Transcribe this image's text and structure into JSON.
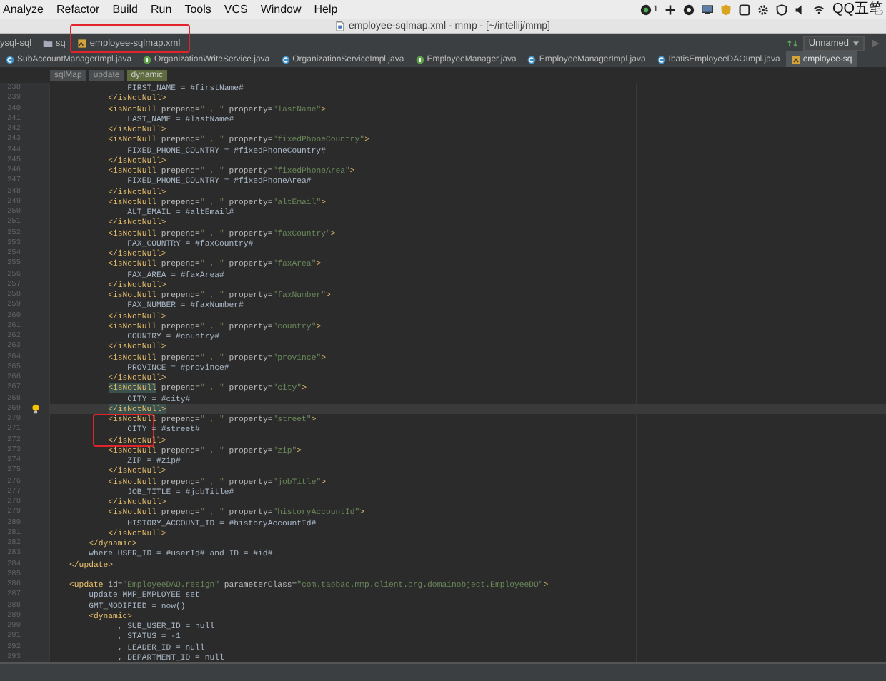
{
  "menu_bar": {
    "items": [
      "Analyze",
      "Refactor",
      "Build",
      "Run",
      "Tools",
      "VCS",
      "Window",
      "Help"
    ],
    "tray": {
      "badge": "1",
      "input_method": "QQ五笔"
    }
  },
  "window": {
    "title": "employee-sqlmap.xml - mmp - [~/intellij/mmp]"
  },
  "nav_bar": {
    "crumbs": [
      {
        "kind": "module",
        "text": "ysql-sql",
        "annotated": false
      },
      {
        "kind": "folder",
        "text": "sq",
        "annotated": false
      },
      {
        "kind": "xml",
        "text": "employee-sqlmap.xml",
        "annotated": true
      }
    ],
    "run_config": "Unnamed"
  },
  "tabs": [
    {
      "kind": "class",
      "label": "SubAccountManagerImpl.java",
      "selected": false
    },
    {
      "kind": "interface",
      "label": "OrganizationWriteService.java",
      "selected": false
    },
    {
      "kind": "class",
      "label": "OrganizationServiceImpl.java",
      "selected": false
    },
    {
      "kind": "interface",
      "label": "EmployeeManager.java",
      "selected": false
    },
    {
      "kind": "class",
      "label": "EmployeeManagerImpl.java",
      "selected": false
    },
    {
      "kind": "class",
      "label": "IbatisEmployeeDAOImpl.java",
      "selected": false
    },
    {
      "kind": "xml",
      "label": "employee-sq",
      "selected": true
    }
  ],
  "breadcrumb": [
    {
      "label": "sqlMap",
      "selected": false
    },
    {
      "label": "update",
      "selected": false
    },
    {
      "label": "dynamic",
      "selected": true
    }
  ],
  "editor": {
    "lines": [
      {
        "num": "238",
        "current": false,
        "tokens": [
          {
            "kind": "text",
            "text": "                FIRST_NAME = #firstName#"
          }
        ]
      },
      {
        "num": "239",
        "current": false,
        "tokens": [
          {
            "kind": "tag",
            "text": "            </isNotNull>"
          }
        ]
      },
      {
        "num": "240",
        "current": false,
        "tokens": [
          {
            "kind": "tag",
            "text": "            <isNotNull"
          },
          {
            "kind": "attr",
            "text": " prepend="
          },
          {
            "kind": "str",
            "text": "\" , \""
          },
          {
            "kind": "attr",
            "text": " property="
          },
          {
            "kind": "str",
            "text": "\"lastName\""
          },
          {
            "kind": "tag",
            "text": ">"
          }
        ]
      },
      {
        "num": "241",
        "current": false,
        "tokens": [
          {
            "kind": "text",
            "text": "                LAST_NAME = #lastName#"
          }
        ]
      },
      {
        "num": "242",
        "current": false,
        "tokens": [
          {
            "kind": "tag",
            "text": "            </isNotNull>"
          }
        ]
      },
      {
        "num": "243",
        "current": false,
        "tokens": [
          {
            "kind": "tag",
            "text": "            <isNotNull"
          },
          {
            "kind": "attr",
            "text": " prepend="
          },
          {
            "kind": "str",
            "text": "\" , \""
          },
          {
            "kind": "attr",
            "text": " property="
          },
          {
            "kind": "str",
            "text": "\"fixedPhoneCountry\""
          },
          {
            "kind": "tag",
            "text": ">"
          }
        ]
      },
      {
        "num": "244",
        "current": false,
        "tokens": [
          {
            "kind": "text",
            "text": "                FIXED_PHONE_COUNTRY = #fixedPhoneCountry#"
          }
        ]
      },
      {
        "num": "245",
        "current": false,
        "tokens": [
          {
            "kind": "tag",
            "text": "            </isNotNull>"
          }
        ]
      },
      {
        "num": "246",
        "current": false,
        "tokens": [
          {
            "kind": "tag",
            "text": "            <isNotNull"
          },
          {
            "kind": "attr",
            "text": " prepend="
          },
          {
            "kind": "str",
            "text": "\" , \""
          },
          {
            "kind": "attr",
            "text": " property="
          },
          {
            "kind": "str",
            "text": "\"fixedPhoneArea\""
          },
          {
            "kind": "tag",
            "text": ">"
          }
        ]
      },
      {
        "num": "247",
        "current": false,
        "tokens": [
          {
            "kind": "text",
            "text": "                FIXED_PHONE_COUNTRY = #fixedPhoneArea#"
          }
        ]
      },
      {
        "num": "248",
        "current": false,
        "tokens": [
          {
            "kind": "tag",
            "text": "            </isNotNull>"
          }
        ]
      },
      {
        "num": "249",
        "current": false,
        "tokens": [
          {
            "kind": "tag",
            "text": "            <isNotNull"
          },
          {
            "kind": "attr",
            "text": " prepend="
          },
          {
            "kind": "str",
            "text": "\" , \""
          },
          {
            "kind": "attr",
            "text": " property="
          },
          {
            "kind": "str",
            "text": "\"altEmail\""
          },
          {
            "kind": "tag",
            "text": ">"
          }
        ]
      },
      {
        "num": "250",
        "current": false,
        "tokens": [
          {
            "kind": "text",
            "text": "                ALT_EMAIL = #altEmail#"
          }
        ]
      },
      {
        "num": "251",
        "current": false,
        "tokens": [
          {
            "kind": "tag",
            "text": "            </isNotNull>"
          }
        ]
      },
      {
        "num": "252",
        "current": false,
        "tokens": [
          {
            "kind": "tag",
            "text": "            <isNotNull"
          },
          {
            "kind": "attr",
            "text": " prepend="
          },
          {
            "kind": "str",
            "text": "\" , \""
          },
          {
            "kind": "attr",
            "text": " property="
          },
          {
            "kind": "str",
            "text": "\"faxCountry\""
          },
          {
            "kind": "tag",
            "text": ">"
          }
        ]
      },
      {
        "num": "253",
        "current": false,
        "tokens": [
          {
            "kind": "text",
            "text": "                FAX_COUNTRY = #faxCountry#"
          }
        ]
      },
      {
        "num": "254",
        "current": false,
        "tokens": [
          {
            "kind": "tag",
            "text": "            </isNotNull>"
          }
        ]
      },
      {
        "num": "255",
        "current": false,
        "tokens": [
          {
            "kind": "tag",
            "text": "            <isNotNull"
          },
          {
            "kind": "attr",
            "text": " prepend="
          },
          {
            "kind": "str",
            "text": "\" , \""
          },
          {
            "kind": "attr",
            "text": " property="
          },
          {
            "kind": "str",
            "text": "\"faxArea\""
          },
          {
            "kind": "tag",
            "text": ">"
          }
        ]
      },
      {
        "num": "256",
        "current": false,
        "tokens": [
          {
            "kind": "text",
            "text": "                FAX_AREA = #faxArea#"
          }
        ]
      },
      {
        "num": "257",
        "current": false,
        "tokens": [
          {
            "kind": "tag",
            "text": "            </isNotNull>"
          }
        ]
      },
      {
        "num": "258",
        "current": false,
        "tokens": [
          {
            "kind": "tag",
            "text": "            <isNotNull"
          },
          {
            "kind": "attr",
            "text": " prepend="
          },
          {
            "kind": "str",
            "text": "\" , \""
          },
          {
            "kind": "attr",
            "text": " property="
          },
          {
            "kind": "str",
            "text": "\"faxNumber\""
          },
          {
            "kind": "tag",
            "text": ">"
          }
        ]
      },
      {
        "num": "259",
        "current": false,
        "tokens": [
          {
            "kind": "text",
            "text": "                FAX_NUMBER = #faxNumber#"
          }
        ]
      },
      {
        "num": "260",
        "current": false,
        "tokens": [
          {
            "kind": "tag",
            "text": "            </isNotNull>"
          }
        ]
      },
      {
        "num": "261",
        "current": false,
        "tokens": [
          {
            "kind": "tag",
            "text": "            <isNotNull"
          },
          {
            "kind": "attr",
            "text": " prepend="
          },
          {
            "kind": "str",
            "text": "\" , \""
          },
          {
            "kind": "attr",
            "text": " property="
          },
          {
            "kind": "str",
            "text": "\"country\""
          },
          {
            "kind": "tag",
            "text": ">"
          }
        ]
      },
      {
        "num": "262",
        "current": false,
        "tokens": [
          {
            "kind": "text",
            "text": "                COUNTRY = #country#"
          }
        ]
      },
      {
        "num": "263",
        "current": false,
        "tokens": [
          {
            "kind": "tag",
            "text": "            </isNotNull>"
          }
        ]
      },
      {
        "num": "264",
        "current": false,
        "tokens": [
          {
            "kind": "tag",
            "text": "            <isNotNull"
          },
          {
            "kind": "attr",
            "text": " prepend="
          },
          {
            "kind": "str",
            "text": "\" , \""
          },
          {
            "kind": "attr",
            "text": " property="
          },
          {
            "kind": "str",
            "text": "\"province\""
          },
          {
            "kind": "tag",
            "text": ">"
          }
        ]
      },
      {
        "num": "265",
        "current": false,
        "tokens": [
          {
            "kind": "text",
            "text": "                PROVINCE = #province#"
          }
        ]
      },
      {
        "num": "266",
        "current": false,
        "tokens": [
          {
            "kind": "tag",
            "text": "            </isNotNull>"
          }
        ]
      },
      {
        "num": "267",
        "current": false,
        "tokens": [
          {
            "kind": "match",
            "text": "            <isNotNull"
          },
          {
            "kind": "attr",
            "text": " prepend="
          },
          {
            "kind": "str",
            "text": "\" , \""
          },
          {
            "kind": "attr",
            "text": " property="
          },
          {
            "kind": "str",
            "text": "\"city\""
          },
          {
            "kind": "tag",
            "text": ">"
          }
        ]
      },
      {
        "num": "268",
        "current": false,
        "tokens": [
          {
            "kind": "text",
            "text": "                CITY = #city#"
          }
        ]
      },
      {
        "num": "269",
        "current": true,
        "tokens": [
          {
            "kind": "match",
            "text": "            </isNotNull>"
          }
        ]
      },
      {
        "num": "270",
        "current": false,
        "tokens": [
          {
            "kind": "tag",
            "text": "            <isNotNull"
          },
          {
            "kind": "attr",
            "text": " prepend="
          },
          {
            "kind": "str",
            "text": "\" , \""
          },
          {
            "kind": "attr",
            "text": " property="
          },
          {
            "kind": "str",
            "text": "\"street\""
          },
          {
            "kind": "tag",
            "text": ">"
          }
        ]
      },
      {
        "num": "271",
        "current": false,
        "tokens": [
          {
            "kind": "text",
            "text": "                CITY = #street#"
          }
        ]
      },
      {
        "num": "272",
        "current": false,
        "tokens": [
          {
            "kind": "tag",
            "text": "            </isNotNull>"
          }
        ]
      },
      {
        "num": "273",
        "current": false,
        "tokens": [
          {
            "kind": "tag",
            "text": "            <isNotNull"
          },
          {
            "kind": "attr",
            "text": " prepend="
          },
          {
            "kind": "str",
            "text": "\" , \""
          },
          {
            "kind": "attr",
            "text": " property="
          },
          {
            "kind": "str",
            "text": "\"zip\""
          },
          {
            "kind": "tag",
            "text": ">"
          }
        ]
      },
      {
        "num": "274",
        "current": false,
        "tokens": [
          {
            "kind": "text",
            "text": "                ZIP = #zip#"
          }
        ]
      },
      {
        "num": "275",
        "current": false,
        "tokens": [
          {
            "kind": "tag",
            "text": "            </isNotNull>"
          }
        ]
      },
      {
        "num": "276",
        "current": false,
        "tokens": [
          {
            "kind": "tag",
            "text": "            <isNotNull"
          },
          {
            "kind": "attr",
            "text": " prepend="
          },
          {
            "kind": "str",
            "text": "\" , \""
          },
          {
            "kind": "attr",
            "text": " property="
          },
          {
            "kind": "str",
            "text": "\"jobTitle\""
          },
          {
            "kind": "tag",
            "text": ">"
          }
        ]
      },
      {
        "num": "277",
        "current": false,
        "tokens": [
          {
            "kind": "text",
            "text": "                JOB_TITLE = #jobTitle#"
          }
        ]
      },
      {
        "num": "278",
        "current": false,
        "tokens": [
          {
            "kind": "tag",
            "text": "            </isNotNull>"
          }
        ]
      },
      {
        "num": "279",
        "current": false,
        "tokens": [
          {
            "kind": "tag",
            "text": "            <isNotNull"
          },
          {
            "kind": "attr",
            "text": " prepend="
          },
          {
            "kind": "str",
            "text": "\" , \""
          },
          {
            "kind": "attr",
            "text": " property="
          },
          {
            "kind": "str",
            "text": "\"historyAccountId\""
          },
          {
            "kind": "tag",
            "text": ">"
          }
        ]
      },
      {
        "num": "280",
        "current": false,
        "tokens": [
          {
            "kind": "text",
            "text": "                HISTORY_ACCOUNT_ID = #historyAccountId#"
          }
        ]
      },
      {
        "num": "281",
        "current": false,
        "tokens": [
          {
            "kind": "tag",
            "text": "            </isNotNull>"
          }
        ]
      },
      {
        "num": "282",
        "current": false,
        "tokens": [
          {
            "kind": "tag",
            "text": "        </dynamic>"
          }
        ]
      },
      {
        "num": "283",
        "current": false,
        "tokens": [
          {
            "kind": "text",
            "text": "        where USER_ID = #userId# and ID = #id#"
          }
        ]
      },
      {
        "num": "284",
        "current": false,
        "tokens": [
          {
            "kind": "tag",
            "text": "    </update>"
          }
        ]
      },
      {
        "num": "285",
        "current": false
      },
      {
        "num": "286",
        "current": false,
        "tokens": [
          {
            "kind": "tag",
            "text": "    <update"
          },
          {
            "kind": "attr",
            "text": " id="
          },
          {
            "kind": "str",
            "text": "\"EmployeeDAO.resign\""
          },
          {
            "kind": "attr",
            "text": " parameterClass="
          },
          {
            "kind": "str",
            "text": "\"com.taobao.mmp.client.org.domainobject.EmployeeDO\""
          },
          {
            "kind": "tag",
            "text": ">"
          }
        ]
      },
      {
        "num": "287",
        "current": false,
        "tokens": [
          {
            "kind": "text",
            "text": "        update MMP_EMPLOYEE set"
          }
        ]
      },
      {
        "num": "288",
        "current": false,
        "tokens": [
          {
            "kind": "text",
            "text": "        GMT_MODIFIED = now()"
          }
        ]
      },
      {
        "num": "289",
        "current": false,
        "tokens": [
          {
            "kind": "tag",
            "text": "        <dynamic>"
          }
        ]
      },
      {
        "num": "290",
        "current": false,
        "tokens": [
          {
            "kind": "text",
            "text": "              , SUB_USER_ID = null"
          }
        ]
      },
      {
        "num": "291",
        "current": false,
        "tokens": [
          {
            "kind": "text",
            "text": "              , STATUS = -1"
          }
        ]
      },
      {
        "num": "292",
        "current": false,
        "tokens": [
          {
            "kind": "text",
            "text": "              , LEADER_ID = null"
          }
        ]
      },
      {
        "num": "293",
        "current": false,
        "tokens": [
          {
            "kind": "text",
            "text": "              , DEPARTMENT_ID = null"
          }
        ]
      }
    ]
  }
}
